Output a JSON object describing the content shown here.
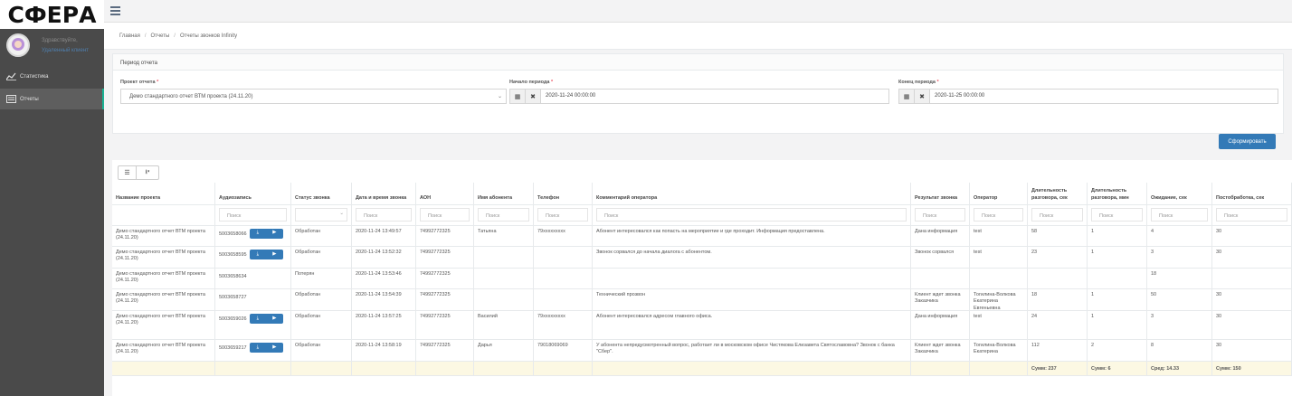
{
  "brand": {
    "logo": "СФЕРА"
  },
  "user": {
    "name": "Здравствуйте,",
    "role": "Удаленный клиент"
  },
  "nav": [
    {
      "label": "Статистика",
      "icon": "chart-line-icon"
    },
    {
      "label": "Отчеты",
      "icon": "list-icon"
    }
  ],
  "breadcrumb": [
    "Главная",
    "Отчеты",
    "Отчеты звонков Infinity"
  ],
  "period_panel": {
    "title": "Период отчета",
    "project_label": "Проект отчета",
    "project_value": "Демо стандартного отчет ВТМ проекта (24.11.20)",
    "start_label": "Начало периода",
    "start_value": "2020-11-24 00:00:00",
    "end_label": "Конец периода",
    "end_value": "2020-11-25 00:00:00",
    "submit_label": "Сформировать"
  },
  "table": {
    "columns": [
      "Название проекта",
      "Аудиозапись",
      "Статус звонка",
      "Дата и время звонка",
      "АОН",
      "Имя абонента",
      "Телефон",
      "Комментарий оператора",
      "Результат звонка",
      "Оператор",
      "Длительность разговора, сек",
      "Длительность разговора, мин",
      "Ожидание, сек",
      "Постобработка, сек"
    ],
    "filter_placeholder": "Поиск",
    "rows": [
      [
        "Демо стандартного отчет ВТМ проекта (24.11.20)",
        "5003658066",
        "Обработан",
        "2020-11-24 13:49:57",
        "74992772325",
        "Татьяна",
        "79ххххххххх",
        "Абонент интересовался как попасть на мероприятие и где проходит. Информация предоставлена.",
        "Дана информация",
        "test",
        "58",
        "1",
        "4",
        "30"
      ],
      [
        "Демо стандартного отчет ВТМ проекта (24.11.20)",
        "5003658595",
        "Обработан",
        "2020-11-24 13:52:32",
        "74992772325",
        "",
        "",
        "Звонок сорвался до начала диалога с абонентом.",
        "Звонок сорвался",
        "test",
        "23",
        "1",
        "3",
        "30"
      ],
      [
        "Демо стандартного отчет ВТМ проекта (24.11.20)",
        "5003658634",
        "Потерян",
        "2020-11-24 13:53:46",
        "74992772325",
        "",
        "",
        "",
        "",
        "",
        "",
        "",
        "18",
        ""
      ],
      [
        "Демо стандартного отчет ВТМ проекта (24.11.20)",
        "5003658727",
        "Обработан",
        "2020-11-24 13:54:39",
        "74992772325",
        "",
        "",
        "Технический прозвон",
        "Клиент ждет звонка Заказчика",
        "Тогилина-Волкова Екатерина Евгеньевна",
        "18",
        "1",
        "50",
        "30"
      ],
      [
        "Демо стандартного отчет ВТМ проекта (24.11.20)",
        "5003659026",
        "Обработан",
        "2020-11-24 13:57:25",
        "74992772325",
        "Василий",
        "79ххххххххх",
        "Абонент интересовался адресом главного офиса.",
        "Дана информация",
        "test",
        "24",
        "1",
        "3",
        "30"
      ],
      [
        "Демо стандартного отчет ВТМ проекта (24.11.20)",
        "5003659217",
        "Обработан",
        "2020-11-24 13:58:19",
        "74992772325",
        "Дарья",
        "79018069069",
        "У абонента непредусмотренный вопрос, работает ли в московском офисе Чистякова Елизавета Святославовна? Звонок с банка \"Сбер\".",
        "Клиент ждет звонка Заказчика",
        "Тогилина-Волкова Екатерина",
        "112",
        "2",
        "8",
        "30"
      ]
    ],
    "summary": [
      "",
      "",
      "",
      "",
      "",
      "",
      "",
      "",
      "",
      "",
      "Сумм: 237",
      "Сумм: 6",
      "Сред: 14.33",
      "Сумм: 150"
    ]
  },
  "colors": {
    "sidebar": "#4a4a4a",
    "accent": "#337ab7",
    "active_border": "#1ab394",
    "required": "#ed5565",
    "summary_bg": "#fcf8e3"
  }
}
